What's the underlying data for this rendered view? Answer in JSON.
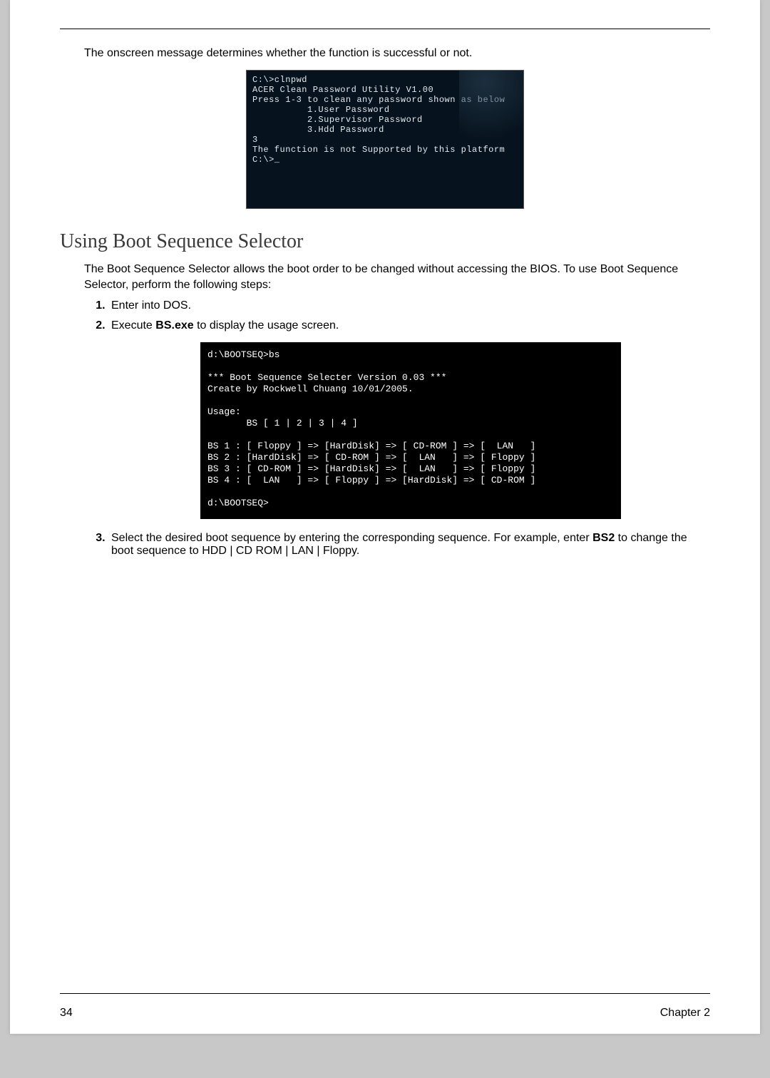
{
  "intro": "The onscreen message determines whether the function is successful or not.",
  "bios": {
    "l1": "C:\\>clnpwd",
    "l2": "ACER Clean Password Utility V1.00",
    "l3a": "Press 1-3 to clean any password shown ",
    "l3b": "as below",
    "l4": "          1.User Password",
    "l5": "          2.Supervisor Password",
    "l6": "          3.Hdd Password",
    "l7": "3",
    "l8": "The function is not Supported by this platform",
    "l9": "C:\\>_"
  },
  "section_title": "Using Boot Sequence Selector",
  "section_body": "The Boot Sequence Selector allows the boot order to be changed without accessing the BIOS. To use Boot Sequence Selector, perform the following steps:",
  "steps": {
    "s1": "Enter into DOS.",
    "s2a": "Execute ",
    "s2b": "BS.exe",
    "s2c": " to display the usage screen.",
    "s3a": "Select the desired boot sequence by entering the corresponding sequence. For example, enter ",
    "s3b": "BS2",
    "s3c": " to change the boot sequence to HDD | CD ROM | LAN | Floppy."
  },
  "dos": {
    "l1": "d:\\BOOTSEQ>bs",
    "l2": "",
    "l3": "*** Boot Sequence Selecter Version 0.03 ***",
    "l4": "Create by Rockwell Chuang 10/01/2005.",
    "l5": "",
    "l6": "Usage:",
    "l7": "       BS [ 1 | 2 | 3 | 4 ]",
    "l8": "",
    "l9": "BS 1 : [ Floppy ] => [HardDisk] => [ CD-ROM ] => [  LAN   ]",
    "l10": "BS 2 : [HardDisk] => [ CD-ROM ] => [  LAN   ] => [ Floppy ]",
    "l11": "BS 3 : [ CD-ROM ] => [HardDisk] => [  LAN   ] => [ Floppy ]",
    "l12": "BS 4 : [  LAN   ] => [ Floppy ] => [HardDisk] => [ CD-ROM ]",
    "l13": "",
    "l14": "d:\\BOOTSEQ>"
  },
  "footer": {
    "page": "34",
    "chapter": "Chapter 2"
  }
}
